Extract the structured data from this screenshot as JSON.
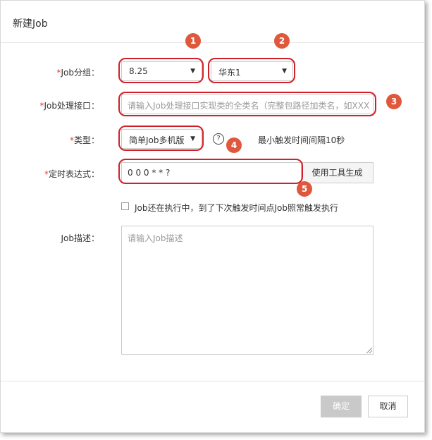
{
  "dialog": {
    "title": "新建Job"
  },
  "form": {
    "group": {
      "required_mark": "*",
      "label": "Job分组：",
      "primary_value": "8.25",
      "secondary_value": "华东1"
    },
    "handler": {
      "required_mark": "*",
      "label": "Job处理接口：",
      "placeholder": "请输入Job处理接口实现类的全类名（完整包路径加类名，如XXX）"
    },
    "type": {
      "required_mark": "*",
      "label": "类型：",
      "value": "简单Job多机版",
      "help_icon": "?",
      "hint": "最小触发时间间隔10秒"
    },
    "cron": {
      "required_mark": "*",
      "label": "定时表达式：",
      "value": "0 0 0 * * ?",
      "tool_button": "使用工具生成"
    },
    "overlap": {
      "label": "Job还在执行中，到了下次触发时间点Job照常触发执行",
      "checked": false
    },
    "description": {
      "label": "Job描述：",
      "placeholder": "请输入Job描述"
    }
  },
  "footer": {
    "confirm_label": "确定",
    "cancel_label": "取消"
  },
  "annotations": [
    "1",
    "2",
    "3",
    "4",
    "5"
  ],
  "colors": {
    "annotation_badge": "#e0583c",
    "annotation_outline": "#d0202a",
    "required": "#e53935"
  }
}
